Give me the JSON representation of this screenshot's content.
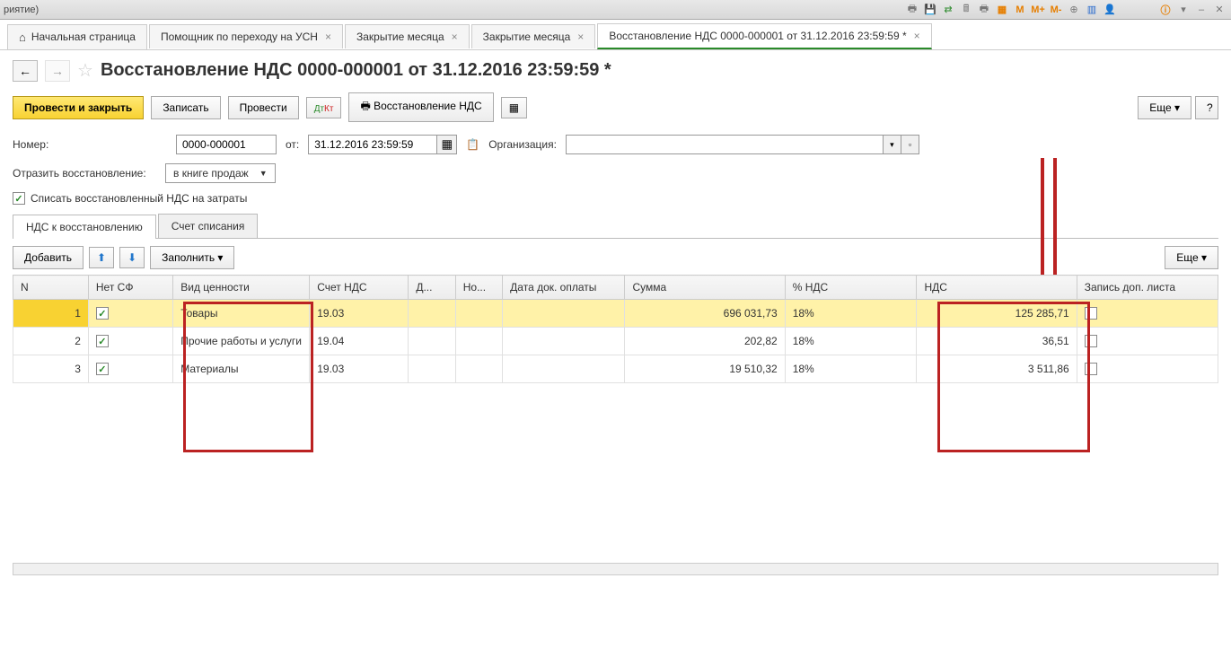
{
  "topbar": {
    "left_text": "риятие)"
  },
  "tabs": {
    "home": "Начальная страница",
    "items": [
      {
        "label": "Помощник по переходу на УСН"
      },
      {
        "label": "Закрытие месяца"
      },
      {
        "label": "Закрытие месяца"
      },
      {
        "label": "Восстановление НДС 0000-000001 от 31.12.2016 23:59:59 *",
        "active": true
      }
    ]
  },
  "page": {
    "title": "Восстановление НДС 0000-000001 от 31.12.2016 23:59:59 *"
  },
  "toolbar": {
    "post_close": "Провести и закрыть",
    "save": "Записать",
    "post": "Провести",
    "print": "Восстановление НДС",
    "more": "Еще"
  },
  "form": {
    "number_label": "Номер:",
    "number_value": "0000-000001",
    "date_label": "от:",
    "date_value": "31.12.2016 23:59:59",
    "org_label": "Организация:",
    "org_value": "",
    "reflect_label": "Отразить восстановление:",
    "reflect_value": "в книге продаж",
    "writeoff_checkbox": "Списать восстановленный НДС на затраты"
  },
  "inner_tabs": {
    "tab1": "НДС к восстановлению",
    "tab2": "Счет списания"
  },
  "table_toolbar": {
    "add": "Добавить",
    "fill": "Заполнить",
    "more": "Еще"
  },
  "table": {
    "headers": {
      "n": "N",
      "nosf": "Нет СФ",
      "type": "Вид ценности",
      "acc": "Счет НДС",
      "d": "Д...",
      "no": "Но...",
      "date": "Дата док. оплаты",
      "sum": "Сумма",
      "pct": "% НДС",
      "nds": "НДС",
      "rec": "Запись доп. листа"
    },
    "rows": [
      {
        "n": "1",
        "chk": true,
        "type": "Товары",
        "acc": "19.03",
        "sum": "696 031,73",
        "pct": "18%",
        "nds": "125 285,71",
        "selected": true
      },
      {
        "n": "2",
        "chk": true,
        "type": "Прочие работы и услуги",
        "acc": "19.04",
        "sum": "202,82",
        "pct": "18%",
        "nds": "36,51"
      },
      {
        "n": "3",
        "chk": true,
        "type": "Материалы",
        "acc": "19.03",
        "sum": "19 510,32",
        "pct": "18%",
        "nds": "3 511,86"
      }
    ]
  }
}
